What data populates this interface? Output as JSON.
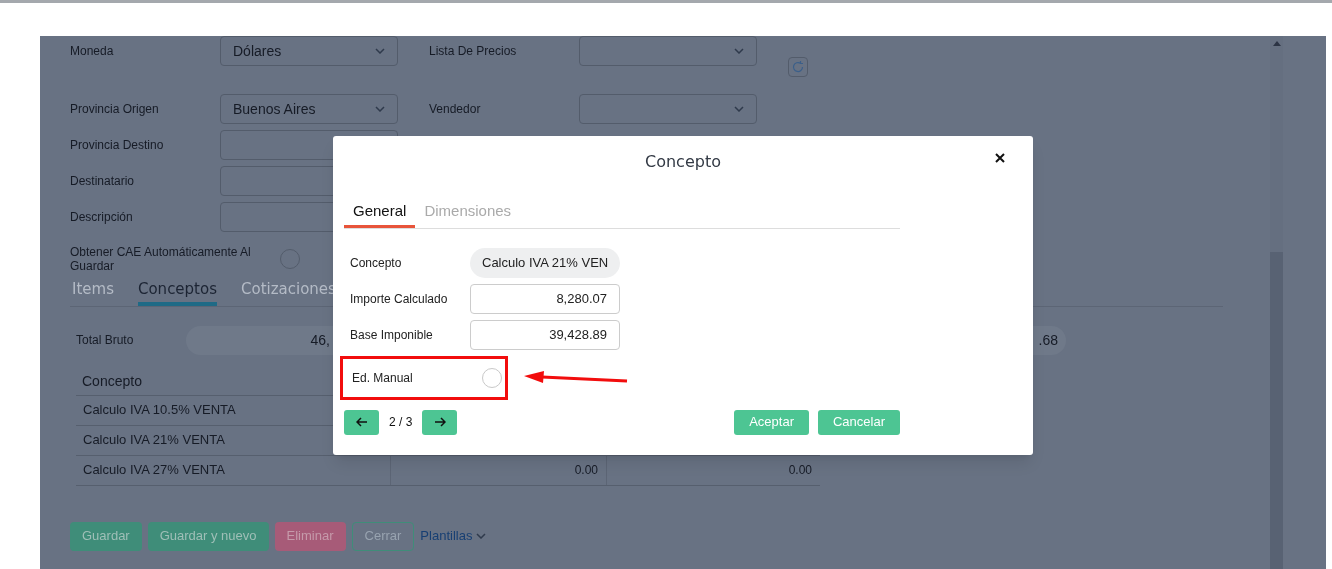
{
  "form": {
    "rows": [
      {
        "left": {
          "label": "Moneda",
          "kind": "select",
          "value": "Dólares"
        },
        "right": {
          "label": "Lista De Precios",
          "kind": "select"
        },
        "refresh": true
      },
      {
        "left": {
          "label": "Provincia Origen",
          "kind": "select",
          "value": "Buenos Aires"
        },
        "right": {
          "label": "Vendedor",
          "kind": "select"
        }
      },
      {
        "left": {
          "label": "Provincia Destino",
          "kind": "input"
        }
      },
      {
        "left": {
          "label": "Destinatario",
          "kind": "input"
        }
      },
      {
        "left": {
          "label": "Descripción",
          "kind": "input"
        }
      },
      {
        "left": {
          "label": "Obtener CAE Automáticamente Al Guardar",
          "kind": "radio",
          "checked": false
        }
      }
    ]
  },
  "tabs": [
    {
      "label": "Items",
      "selected": false
    },
    {
      "label": "Conceptos",
      "selected": true
    },
    {
      "label": "Cotizaciones",
      "selected": false
    }
  ],
  "totals": {
    "label": "Total Bruto",
    "value": "46,",
    "value_2": ".68"
  },
  "table": {
    "columns": [
      "Concepto"
    ],
    "rows": [
      {
        "concepto": "Calculo IVA 10.5% VENTA"
      },
      {
        "concepto": "Calculo IVA 21% VENTA"
      },
      {
        "concepto": "Calculo IVA 27% VENTA",
        "column_2": "0.00",
        "column_3": "0.00"
      }
    ]
  },
  "actions": [
    {
      "label": "Guardar",
      "kind": "primary"
    },
    {
      "label": "Guardar y nuevo",
      "kind": "primary"
    },
    {
      "label": "Eliminar",
      "kind": "danger"
    },
    {
      "label": "Cerrar",
      "kind": "outline"
    },
    {
      "label": "Plantillas",
      "kind": "menu"
    }
  ],
  "modal": {
    "title": "Concepto",
    "tabs": [
      {
        "label": "General",
        "selected": true
      },
      {
        "label": "Dimensiones",
        "selected": false
      }
    ],
    "fields": [
      {
        "label": "Concepto",
        "kind": "pill",
        "value": "Calculo IVA 21% VEN"
      },
      {
        "label": "Importe Calculado",
        "kind": "input",
        "value": "8,280.07"
      },
      {
        "label": "Base Imponible",
        "kind": "input",
        "value": "39,428.89"
      },
      {
        "label": "Ed. Manual",
        "kind": "radio",
        "checked": false,
        "highlighted": true
      }
    ],
    "pager": "2 / 3",
    "buttons": [
      "Aceptar",
      "Cancelar"
    ]
  }
}
